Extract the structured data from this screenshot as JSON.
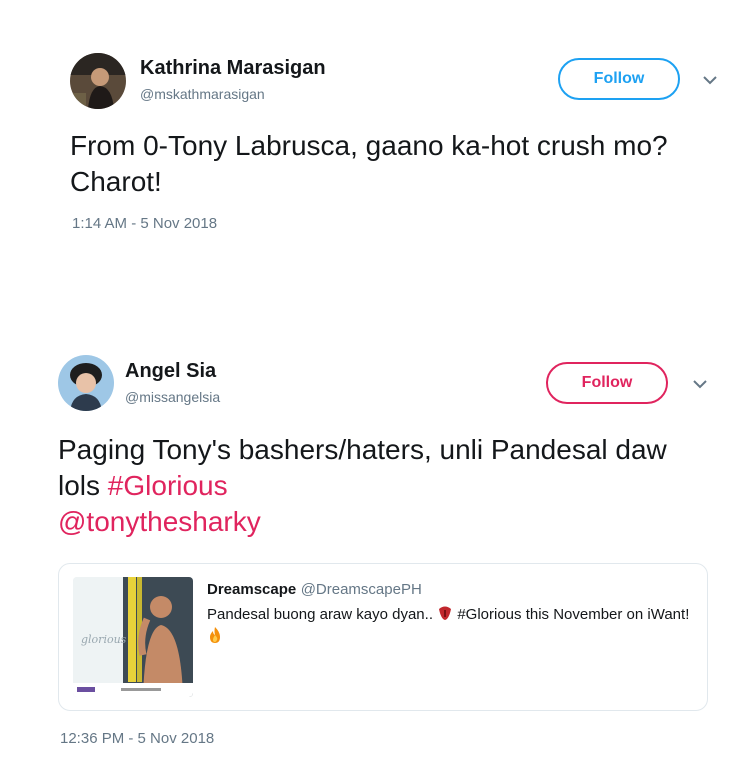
{
  "tweets": [
    {
      "name": "Kathrina Marasigan",
      "handle": "@mskathmarasigan",
      "follow_label": "Follow",
      "follow_color": "#1da1f2",
      "text": "From 0-Tony Labrusca, gaano ka-hot crush mo? Charot!",
      "timestamp": "1:14 AM - 5 Nov 2018"
    },
    {
      "name": "Angel Sia",
      "handle": "@missangelsia",
      "follow_label": "Follow",
      "follow_color": "#e0245e",
      "text_plain": "Paging Tony's bashers/haters, unli Pandesal daw lols ",
      "hashtag": "#Glorious",
      "mention": "@tonythesharky",
      "timestamp": "12:36 PM - 5 Nov 2018",
      "quoted": {
        "name": "Dreamscape",
        "handle": "@DreamscapePH",
        "text_before": "Pandesal buong araw kayo dyan.. ",
        "text_after": " #Glorious this November on iWant! ",
        "emoji_1": "tongue-emoji",
        "emoji_2": "fire-emoji",
        "image_watermark": "glorious"
      }
    }
  ]
}
